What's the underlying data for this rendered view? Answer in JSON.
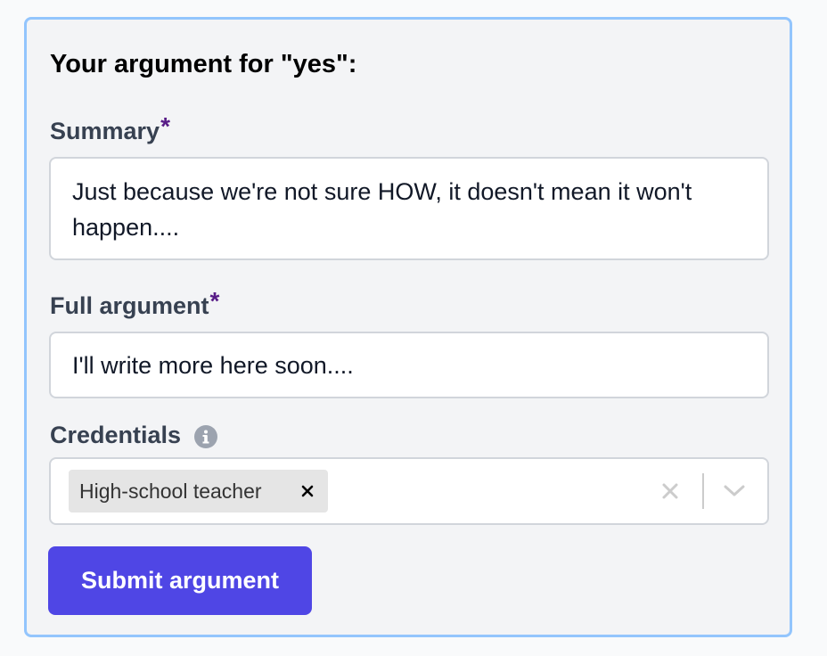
{
  "form": {
    "heading": "Your argument for \"yes\":",
    "required_marker": "*",
    "summary": {
      "label": "Summary",
      "value": "Just because we're not sure HOW, it doesn't mean it won't happen...."
    },
    "full_argument": {
      "label": "Full argument",
      "value": "I'll write more here soon...."
    },
    "credentials": {
      "label": "Credentials",
      "info_icon": "info-icon",
      "selected": [
        "High-school teacher"
      ],
      "remove_icon": "close-icon",
      "clear_icon": "close-icon",
      "dropdown_icon": "chevron-down-icon"
    },
    "submit_label": "Submit argument"
  },
  "colors": {
    "accent": "#4f46e5",
    "card_border": "#93c5fd",
    "required": "#581c87",
    "label": "#374151"
  }
}
